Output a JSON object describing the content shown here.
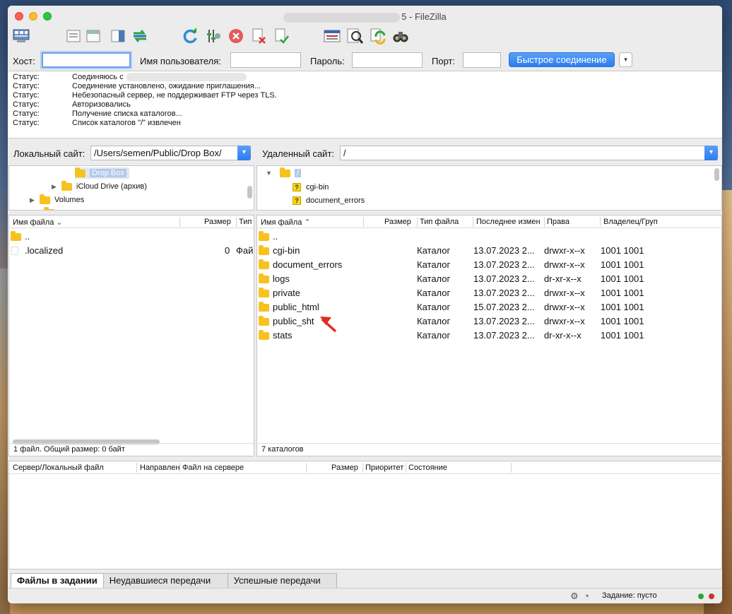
{
  "window": {
    "title_suffix": "5 - FileZilla"
  },
  "toolbar": {
    "icons": [
      "site-manager-icon",
      "toggle-log-icon",
      "toggle-tree-icon",
      "toggle-remote-tree-icon",
      "toggle-queue-icon",
      "refresh-icon",
      "process-queue-icon",
      "cancel-icon",
      "disconnect-icon",
      "reconnect-icon",
      "directory-listing-filters-icon",
      "search-remote-icon",
      "compare-directories-icon",
      "find-files-icon"
    ]
  },
  "quickconnect": {
    "host_label": "Хост:",
    "user_label": "Имя пользователя:",
    "pass_label": "Пароль:",
    "port_label": "Порт:",
    "host_value": "",
    "user_value": "",
    "pass_value": "",
    "port_value": "",
    "connect_button": "Быстрое соединение",
    "dropdown_glyph": "▾"
  },
  "log": [
    {
      "k": "Статус:",
      "v": "Соединяюсь с"
    },
    {
      "k": "Статус:",
      "v": "Соединение установлено, ожидание приглашения..."
    },
    {
      "k": "Статус:",
      "v": "Небезопасный сервер, не поддерживает FTP через TLS."
    },
    {
      "k": "Статус:",
      "v": "Авторизовались"
    },
    {
      "k": "Статус:",
      "v": "Получение списка каталогов..."
    },
    {
      "k": "Статус:",
      "v": "Список каталогов \"/\" извлечен"
    }
  ],
  "local": {
    "site_label": "Локальный сайт:",
    "path": "/Users/semen/Public/Drop Box/",
    "tree": {
      "selected": "Drop Box",
      "icloud": "iCloud Drive (архив)",
      "volumes": "Volumes"
    },
    "headers": {
      "name": "Имя файла",
      "size": "Размер",
      "type": "Тип"
    },
    "files": [
      {
        "name": "..",
        "size": "",
        "type": ""
      },
      {
        "name": ".localized",
        "size": "0",
        "type": "Фай"
      }
    ],
    "status": "1 файл. Общий размер: 0 байт"
  },
  "remote": {
    "site_label": "Удаленный сайт:",
    "path": "/",
    "tree": {
      "root": "/",
      "items": [
        "cgi-bin",
        "document_errors"
      ]
    },
    "headers": {
      "name": "Имя файла",
      "size": "Размер",
      "type": "Тип файла",
      "modified": "Последнее измен",
      "perms": "Права",
      "owner": "Владелец/Груп"
    },
    "files": [
      {
        "name": "..",
        "type": "",
        "modified": "",
        "perms": "",
        "owner": ""
      },
      {
        "name": "cgi-bin",
        "type": "Каталог",
        "modified": "13.07.2023 2...",
        "perms": "drwxr-x--x",
        "owner": "1001 1001"
      },
      {
        "name": "document_errors",
        "type": "Каталог",
        "modified": "13.07.2023 2...",
        "perms": "drwxr-x--x",
        "owner": "1001 1001"
      },
      {
        "name": "logs",
        "type": "Каталог",
        "modified": "13.07.2023 2...",
        "perms": "dr-xr-x--x",
        "owner": "1001 1001"
      },
      {
        "name": "private",
        "type": "Каталог",
        "modified": "13.07.2023 2...",
        "perms": "drwxr-x--x",
        "owner": "1001 1001"
      },
      {
        "name": "public_html",
        "type": "Каталог",
        "modified": "15.07.2023 2...",
        "perms": "drwxr-x--x",
        "owner": "1001 1001"
      },
      {
        "name": "public_sht",
        "type": "Каталог",
        "modified": "13.07.2023 2...",
        "perms": "drwxr-x--x",
        "owner": "1001 1001"
      },
      {
        "name": "stats",
        "type": "Каталог",
        "modified": "13.07.2023 2...",
        "perms": "dr-xr-x--x",
        "owner": "1001 1001"
      }
    ],
    "status": "7 каталогов"
  },
  "queue": {
    "headers": {
      "server": "Сервер/Локальный файл",
      "direction": "Направлен",
      "remote": "Файл на сервере",
      "size": "Размер",
      "priority": "Приоритет",
      "state": "Состояние"
    },
    "tabs": [
      "Файлы в задании",
      "Неудавшиеся передачи",
      "Успешные передачи"
    ]
  },
  "statusbar": {
    "queue": "Задание: пусто"
  },
  "colors": {
    "accent": "#2c7cf0",
    "folder": "#f7c21e",
    "annotation_arrow": "#e02a1e"
  }
}
